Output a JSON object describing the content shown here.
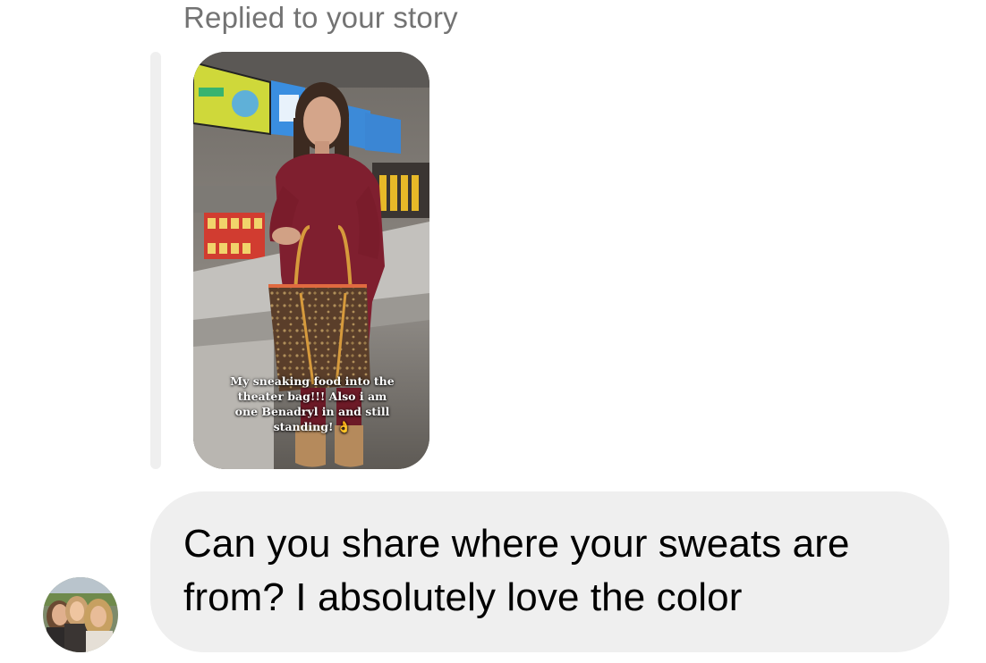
{
  "reply_header": {
    "label": "Replied to your story"
  },
  "story": {
    "caption": "My sneaking food into the theater bag!!! Also i am one Benadryl in and still standing! 👌"
  },
  "message": {
    "text": "Can you share where your sweats are from? I absolutely love the color"
  },
  "sender": {
    "avatar_icon": "profile-photo-avatar"
  },
  "colors": {
    "bubble": "#efefef",
    "secondary_text": "#737373",
    "primary_text": "#000000",
    "reply_bar": "#efefef"
  }
}
